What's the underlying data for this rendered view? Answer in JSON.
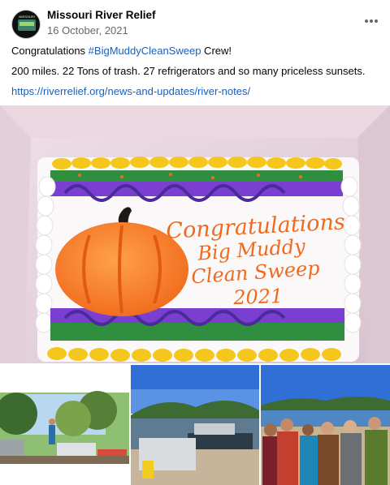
{
  "post": {
    "page_name": "Missouri River Relief",
    "date": "16 October, 2021",
    "avatar_text": "MISSOURI",
    "text_line1_pre": "Congratulations ",
    "hashtag": "#BigMuddyCleanSweep",
    "text_line1_post": " Crew!",
    "text_line2": "200 miles. 22 Tons of trash. 27 refrigerators and so many priceless sunsets.",
    "link": "https://riverrelief.org/news-and-updates/river-notes/"
  },
  "cake": {
    "line1": "Congratulations",
    "line2": "Big Muddy",
    "line3": "Clean Sweep",
    "line4": "2021"
  },
  "icons": {
    "more": "more-options-icon"
  },
  "colors": {
    "link": "#1c5fb8",
    "secondary_text": "#65676b",
    "icing_orange": "#f06a1c"
  }
}
